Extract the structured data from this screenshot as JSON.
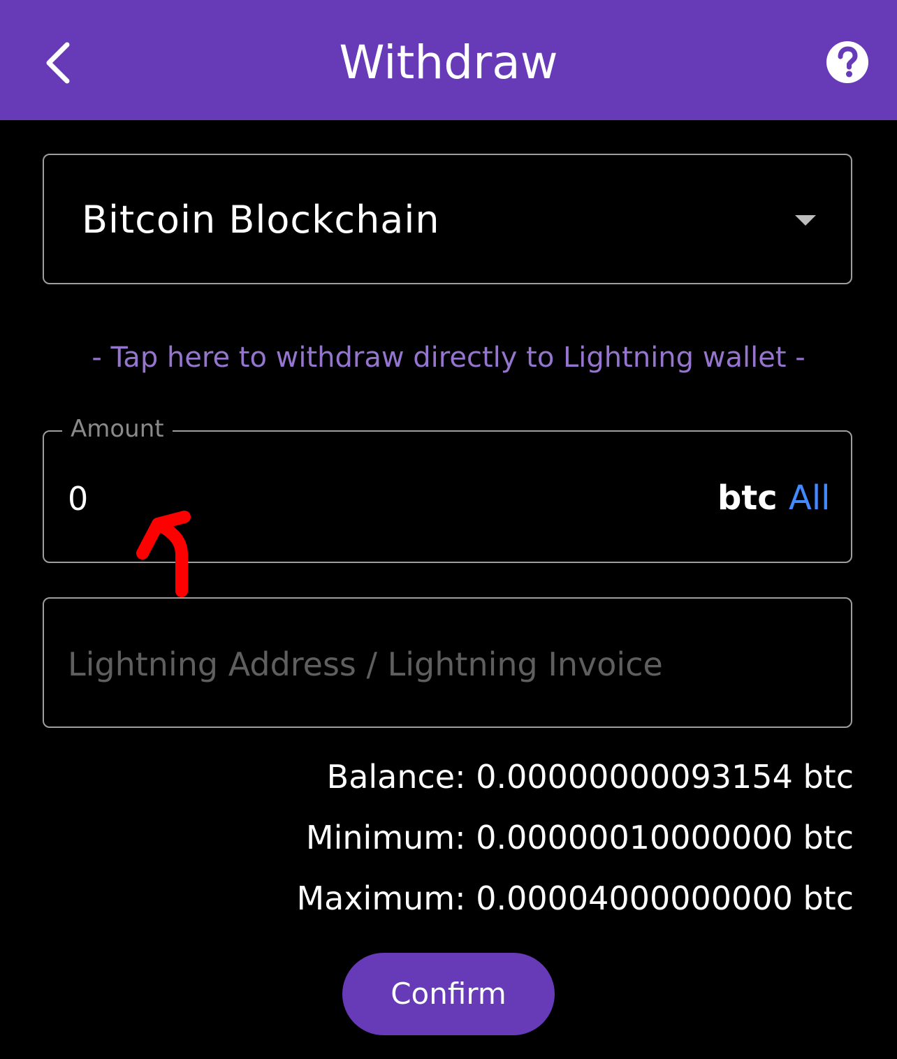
{
  "header": {
    "title": "Withdraw",
    "back_icon": "chevron-left-icon",
    "help_icon": "help-circle-icon"
  },
  "network": {
    "selected": "Bitcoin Blockchain",
    "dropdown_icon": "caret-down-icon"
  },
  "lightning_link": {
    "label": "- Tap here to withdraw directly to Lightning wallet -"
  },
  "amount": {
    "label": "Amount",
    "value": "0",
    "unit": "btc",
    "all_label": "All"
  },
  "address": {
    "placeholder": "Lightning Address / Lightning Invoice",
    "value": ""
  },
  "limits": {
    "balance": "Balance: 0.00000000093154 btc",
    "minimum": "Minimum: 0.00000010000000 btc",
    "maximum": "Maximum: 0.00004000000000 btc"
  },
  "confirm": {
    "label": "Confirm"
  },
  "colors": {
    "brand_purple": "#673ab7",
    "link_purple": "#9575cd",
    "all_blue": "#448aff",
    "annotation_red": "#ff0000",
    "background": "#000000"
  }
}
